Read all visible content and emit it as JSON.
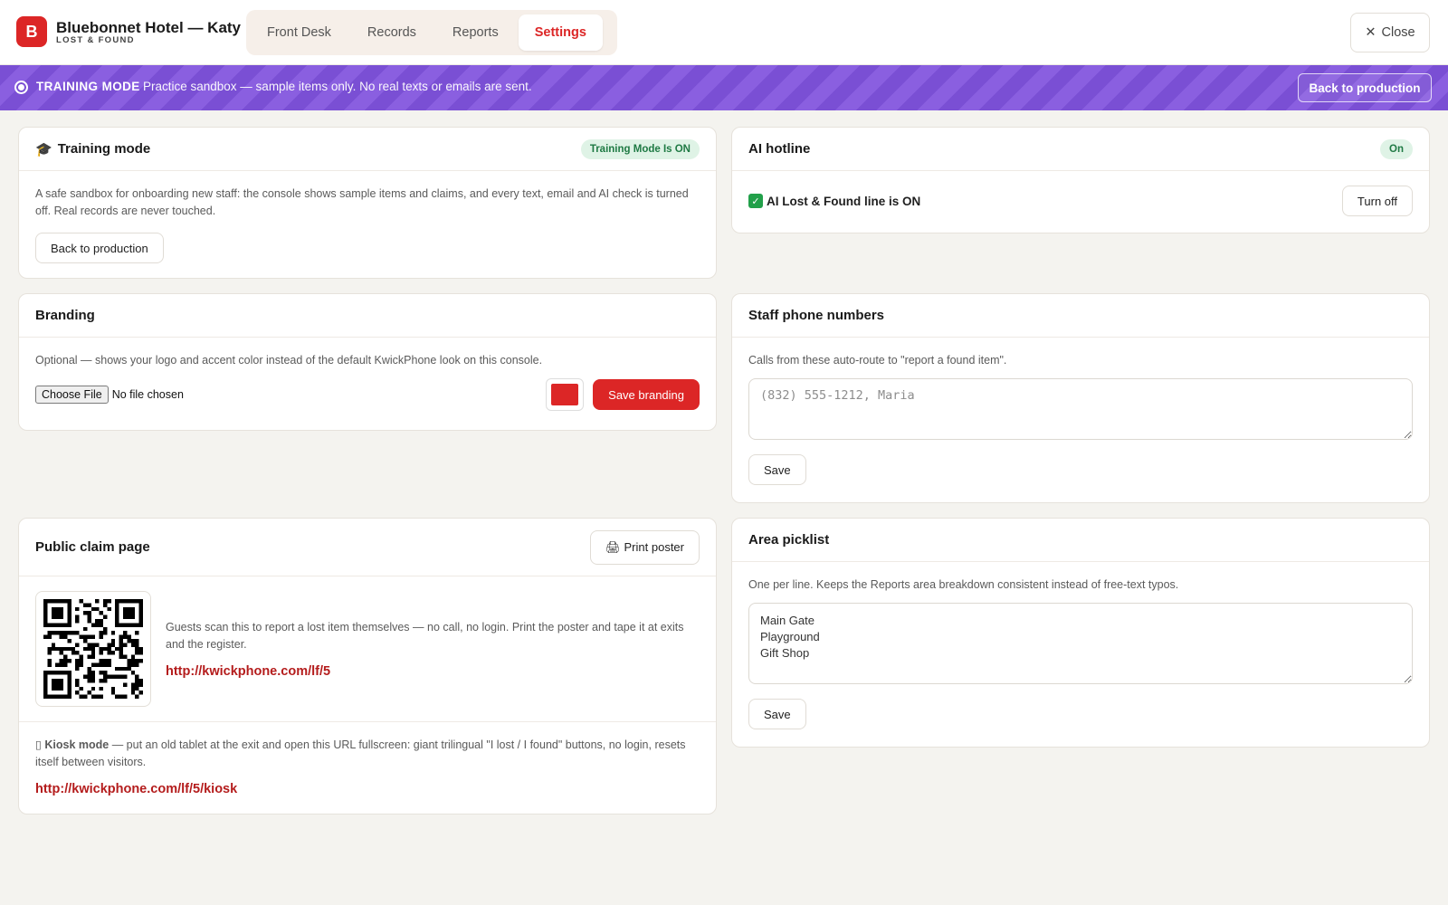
{
  "header": {
    "logo_letter": "B",
    "title": "Bluebonnet Hotel — Katy",
    "subtitle": "LOST & FOUND",
    "tabs": [
      {
        "label": "Front Desk"
      },
      {
        "label": "Records"
      },
      {
        "label": "Reports"
      },
      {
        "label": "Settings",
        "active": true
      }
    ],
    "close_label": "Close",
    "accent": "#dc2626"
  },
  "banner": {
    "label": "TRAINING MODE",
    "message": "Practice sandbox — sample items only. No real texts or emails are sent.",
    "back_label": "Back to production",
    "color": "#7a4fd4"
  },
  "training": {
    "icon": "graduation-cap-icon",
    "title": "Training mode",
    "badge": "Training Mode Is ON",
    "description": "A safe sandbox for onboarding new staff: the console shows sample items and claims, and every text, email and AI check is turned off. Real records are never touched.",
    "button": "Back to production"
  },
  "ai_hotline": {
    "title": "AI hotline",
    "badge": "On",
    "status_icon": "check-mark-icon",
    "status_text": "AI Lost & Found line is ON",
    "button": "Turn off"
  },
  "branding": {
    "title": "Branding",
    "description": "Optional — shows your logo and accent color instead of the default KwickPhone look on this console.",
    "file_button": "Choose File",
    "file_status": "No file chosen",
    "accent_color": "#dc2626",
    "save_button": "Save branding"
  },
  "staff_phones": {
    "title": "Staff phone numbers",
    "description": "Calls from these auto-route to \"report a found item\".",
    "placeholder": "(832) 555-1212, Maria",
    "value": "",
    "save_button": "Save"
  },
  "public_claim": {
    "title": "Public claim page",
    "print_icon": "printer-icon",
    "print_label": "Print poster",
    "description": "Guests scan this to report a lost item themselves — no call, no login. Print the poster and tape it at exits and the register.",
    "url": "http://kwickphone.com/lf/5",
    "kiosk_icon": "tablet-icon",
    "kiosk_bold": "Kiosk mode",
    "kiosk_text": " — put an old tablet at the exit and open this URL fullscreen: giant trilingual \"I lost / I found\" buttons, no login, resets itself between visitors.",
    "kiosk_url": "http://kwickphone.com/lf/5/kiosk"
  },
  "area_picklist": {
    "title": "Area picklist",
    "description": "One per line. Keeps the Reports area breakdown consistent instead of free-text typos.",
    "value": "Main Gate\nPlayground\nGift Shop",
    "save_button": "Save"
  }
}
